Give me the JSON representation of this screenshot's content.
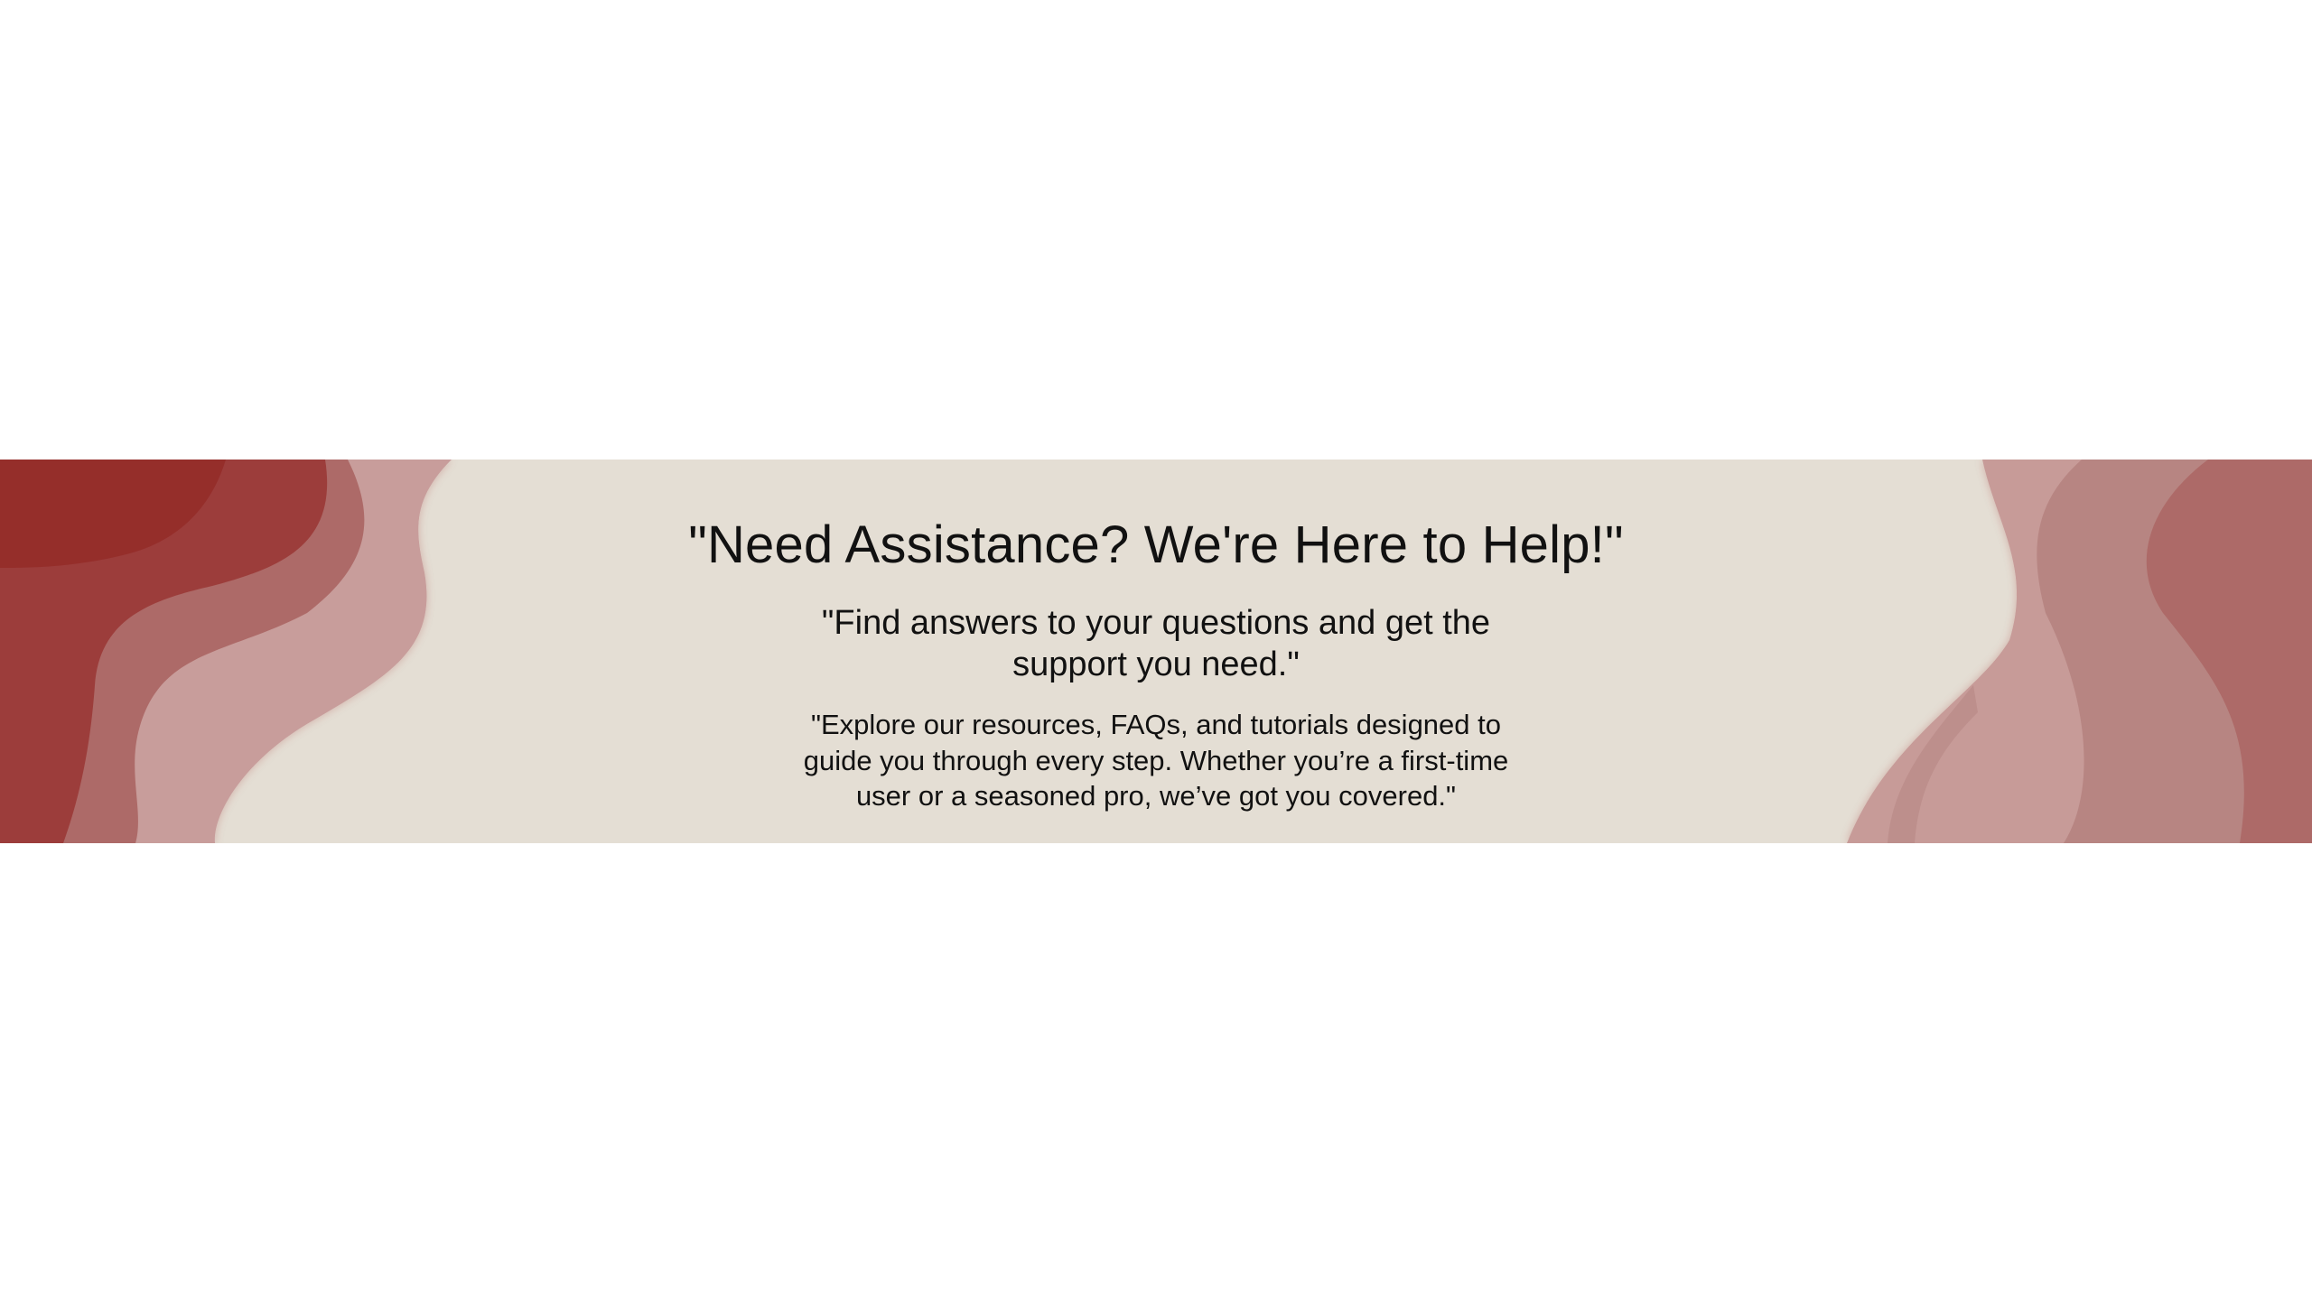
{
  "hero": {
    "headline": "\"Need Assistance? We're Here to Help!\"",
    "subheadline": "\"Find answers to your questions and get the support you need.\"",
    "description": "\"Explore our resources, FAQs, and tutorials designed to guide you through every step. Whether you’re a first-time user or a seasoned pro, we’ve got you covered.\""
  },
  "theme": {
    "page_background": "#ffffff",
    "banner_background": "#e4ded4",
    "accent_dark": "#982d2d",
    "accent_mid": "#ad6a67",
    "accent_light": "#c99b98"
  }
}
